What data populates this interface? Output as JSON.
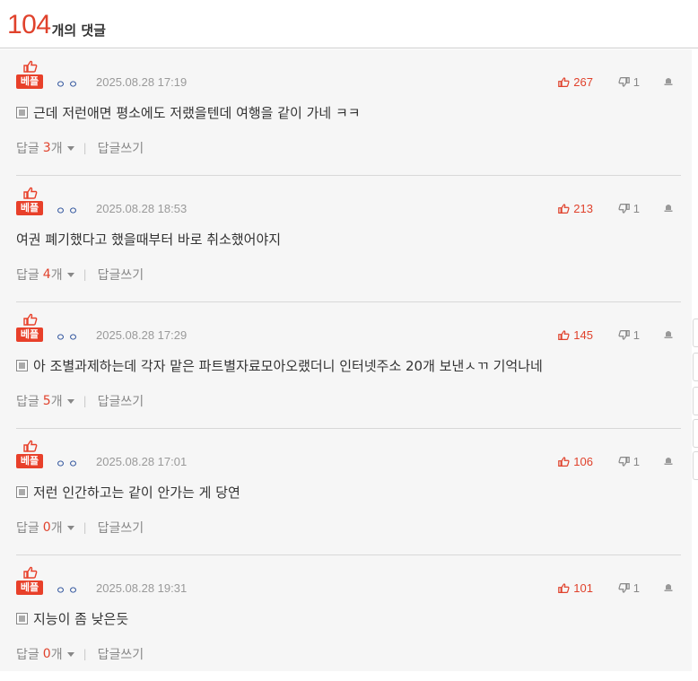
{
  "header": {
    "count": "104",
    "label": "개의 댓글"
  },
  "comments": [
    {
      "badge": "베플",
      "nickname": "ㅇㅇ",
      "date": "2025.08.28 17:19",
      "likes": "267",
      "dislikes": "1",
      "has_image": true,
      "text": "근데 저런애면 평소에도 저랬을텐데 여행을 같이 가네 ㅋㅋ",
      "reply_label": "답글",
      "reply_count": "3",
      "reply_unit": "개",
      "write_reply": "답글쓰기"
    },
    {
      "badge": "베플",
      "nickname": "ㅇㅇ",
      "date": "2025.08.28 18:53",
      "likes": "213",
      "dislikes": "1",
      "has_image": false,
      "text": "여권 폐기했다고 했을때부터 바로 취소했어야지",
      "reply_label": "답글",
      "reply_count": "4",
      "reply_unit": "개",
      "write_reply": "답글쓰기"
    },
    {
      "badge": "베플",
      "nickname": "ㅇㅇ",
      "date": "2025.08.28 17:29",
      "likes": "145",
      "dislikes": "1",
      "has_image": true,
      "text": "아 조별과제하는데 각자 맡은 파트별자료모아오랬더니 인터넷주소 20개 보낸ㅅㄲ 기억나네",
      "reply_label": "답글",
      "reply_count": "5",
      "reply_unit": "개",
      "write_reply": "답글쓰기"
    },
    {
      "badge": "베플",
      "nickname": "ㅇㅇ",
      "date": "2025.08.28 17:01",
      "likes": "106",
      "dislikes": "1",
      "has_image": true,
      "text": "저런 인간하고는 같이 안가는 게 당연",
      "reply_label": "답글",
      "reply_count": "0",
      "reply_unit": "개",
      "write_reply": "답글쓰기"
    },
    {
      "badge": "베플",
      "nickname": "ㅇㅇ",
      "date": "2025.08.28 19:31",
      "likes": "101",
      "dislikes": "1",
      "has_image": true,
      "text": "지능이 좀 낮은듯",
      "reply_label": "답글",
      "reply_count": "0",
      "reply_unit": "개",
      "write_reply": "답글쓰기"
    }
  ],
  "colors": {
    "accent": "#e0422c",
    "badge_bg": "#e8402a",
    "muted": "#888888"
  },
  "icons": {
    "best": "thumbs-up-icon",
    "like": "thumbs-up-icon",
    "dislike": "thumbs-down-icon",
    "report": "report-icon",
    "image": "image-attachment-icon"
  }
}
